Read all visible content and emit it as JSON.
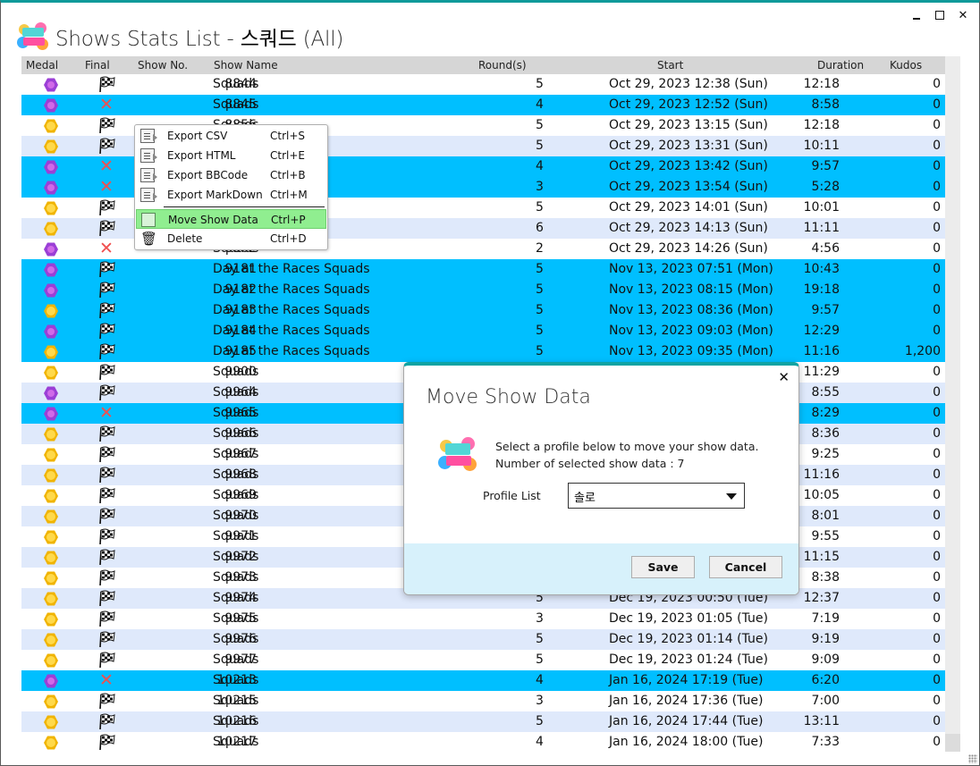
{
  "window": {
    "title_prefix": "Shows Stats List - ",
    "title_profile": "스쿼드",
    "title_suffix": " (All)",
    "controls": {
      "minimize": "minimize",
      "maximize": "maximize",
      "close": "✕"
    }
  },
  "colors": {
    "accent": "#0f9a9a",
    "header_bg": "#d6d6d6",
    "row_alt": "#dfe9fb",
    "row_selected": "#00bfff",
    "menu_highlight": "#90ee90",
    "dialog_footer": "#d7f1fb",
    "medal_purple": "#9b3fd6",
    "medal_gold": "#f0b400",
    "fail_x": "#f04f4f"
  },
  "grid": {
    "columns": [
      "Medal",
      "Final",
      "Show No.",
      "Show Name",
      "Round(s)",
      "Start",
      "Duration",
      "Kudos"
    ],
    "rows": [
      {
        "medal": "purple",
        "final": "flag",
        "num": "8844",
        "name": "Squads",
        "rounds": "5",
        "start": "Oct 29, 2023 12:38 (Sun)",
        "duration": "12:18",
        "kudos": "0",
        "state": "normal"
      },
      {
        "medal": "purple",
        "final": "x",
        "num": "8845",
        "name": "Squads",
        "rounds": "4",
        "start": "Oct 29, 2023 12:52 (Sun)",
        "duration": "8:58",
        "kudos": "0",
        "state": "sel"
      },
      {
        "medal": "gold",
        "final": "flag",
        "num": "8856",
        "name": "Squads",
        "rounds": "5",
        "start": "Oct 29, 2023 13:15 (Sun)",
        "duration": "12:18",
        "kudos": "0",
        "state": "normal"
      },
      {
        "medal": "gold",
        "final": "flag",
        "num": "",
        "name": "",
        "rounds": "5",
        "start": "Oct 29, 2023 13:31 (Sun)",
        "duration": "10:11",
        "kudos": "0",
        "state": "alt"
      },
      {
        "medal": "purple",
        "final": "x",
        "num": "",
        "name": "",
        "rounds": "4",
        "start": "Oct 29, 2023 13:42 (Sun)",
        "duration": "9:57",
        "kudos": "0",
        "state": "sel"
      },
      {
        "medal": "purple",
        "final": "x",
        "num": "",
        "name": "",
        "rounds": "3",
        "start": "Oct 29, 2023 13:54 (Sun)",
        "duration": "5:28",
        "kudos": "0",
        "state": "sel"
      },
      {
        "medal": "gold",
        "final": "flag",
        "num": "",
        "name": "",
        "rounds": "5",
        "start": "Oct 29, 2023 14:01 (Sun)",
        "duration": "10:01",
        "kudos": "0",
        "state": "normal"
      },
      {
        "medal": "gold",
        "final": "flag",
        "num": "",
        "name": "",
        "rounds": "6",
        "start": "Oct 29, 2023 14:13 (Sun)",
        "duration": "11:11",
        "kudos": "0",
        "state": "alt"
      },
      {
        "medal": "purple",
        "final": "x",
        "num": "8862",
        "name": "Squads",
        "rounds": "2",
        "start": "Oct 29, 2023 14:26 (Sun)",
        "duration": "4:56",
        "kudos": "0",
        "state": "normal"
      },
      {
        "medal": "purple",
        "final": "flag",
        "num": "9181",
        "name": "Day at the Races Squads",
        "rounds": "5",
        "start": "Nov 13, 2023 07:51 (Mon)",
        "duration": "10:43",
        "kudos": "0",
        "state": "sel"
      },
      {
        "medal": "purple",
        "final": "flag",
        "num": "9182",
        "name": "Day at the Races Squads",
        "rounds": "5",
        "start": "Nov 13, 2023 08:15 (Mon)",
        "duration": "19:18",
        "kudos": "0",
        "state": "sel"
      },
      {
        "medal": "gold",
        "final": "flag",
        "num": "9183",
        "name": "Day at the Races Squads",
        "rounds": "5",
        "start": "Nov 13, 2023 08:36 (Mon)",
        "duration": "9:57",
        "kudos": "0",
        "state": "sel"
      },
      {
        "medal": "purple",
        "final": "flag",
        "num": "9184",
        "name": "Day at the Races Squads",
        "rounds": "5",
        "start": "Nov 13, 2023 09:03 (Mon)",
        "duration": "12:29",
        "kudos": "0",
        "state": "sel"
      },
      {
        "medal": "gold",
        "final": "flag",
        "num": "9185",
        "name": "Day at the Races Squads",
        "rounds": "5",
        "start": "Nov 13, 2023 09:35 (Mon)",
        "duration": "11:16",
        "kudos": "1,200",
        "state": "sel"
      },
      {
        "medal": "gold",
        "final": "flag",
        "num": "9900",
        "name": "Squads",
        "rounds": "",
        "start": "",
        "duration": "11:29",
        "kudos": "0",
        "state": "normal"
      },
      {
        "medal": "purple",
        "final": "flag",
        "num": "9964",
        "name": "Squads",
        "rounds": "",
        "start": "",
        "duration": "8:55",
        "kudos": "0",
        "state": "alt"
      },
      {
        "medal": "purple",
        "final": "x",
        "num": "9965",
        "name": "Squads",
        "rounds": "",
        "start": "",
        "duration": "8:29",
        "kudos": "0",
        "state": "sel"
      },
      {
        "medal": "gold",
        "final": "flag",
        "num": "9966",
        "name": "Squads",
        "rounds": "",
        "start": "",
        "duration": "8:36",
        "kudos": "0",
        "state": "alt"
      },
      {
        "medal": "gold",
        "final": "flag",
        "num": "9967",
        "name": "Squads",
        "rounds": "",
        "start": "",
        "duration": "9:25",
        "kudos": "0",
        "state": "normal"
      },
      {
        "medal": "gold",
        "final": "flag",
        "num": "9968",
        "name": "Squads",
        "rounds": "",
        "start": "",
        "duration": "11:16",
        "kudos": "0",
        "state": "alt"
      },
      {
        "medal": "gold",
        "final": "flag",
        "num": "9969",
        "name": "Squads",
        "rounds": "",
        "start": "",
        "duration": "10:05",
        "kudos": "0",
        "state": "normal"
      },
      {
        "medal": "gold",
        "final": "flag",
        "num": "9970",
        "name": "Squads",
        "rounds": "",
        "start": "",
        "duration": "8:01",
        "kudos": "0",
        "state": "alt"
      },
      {
        "medal": "gold",
        "final": "flag",
        "num": "9971",
        "name": "Squads",
        "rounds": "",
        "start": "",
        "duration": "9:55",
        "kudos": "0",
        "state": "normal"
      },
      {
        "medal": "gold",
        "final": "flag",
        "num": "9972",
        "name": "Squads",
        "rounds": "",
        "start": "",
        "duration": "11:15",
        "kudos": "0",
        "state": "alt"
      },
      {
        "medal": "gold",
        "final": "flag",
        "num": "9973",
        "name": "Squads",
        "rounds": "",
        "start": "",
        "duration": "8:38",
        "kudos": "0",
        "state": "normal"
      },
      {
        "medal": "gold",
        "final": "flag",
        "num": "9974",
        "name": "Squads",
        "rounds": "5",
        "start": "Dec 19, 2023 00:50 (Tue)",
        "duration": "12:37",
        "kudos": "0",
        "state": "alt"
      },
      {
        "medal": "gold",
        "final": "flag",
        "num": "9975",
        "name": "Squads",
        "rounds": "3",
        "start": "Dec 19, 2023 01:05 (Tue)",
        "duration": "7:19",
        "kudos": "0",
        "state": "normal"
      },
      {
        "medal": "gold",
        "final": "flag",
        "num": "9976",
        "name": "Squads",
        "rounds": "5",
        "start": "Dec 19, 2023 01:14 (Tue)",
        "duration": "9:19",
        "kudos": "0",
        "state": "alt"
      },
      {
        "medal": "gold",
        "final": "flag",
        "num": "9977",
        "name": "Squads",
        "rounds": "5",
        "start": "Dec 19, 2023 01:24 (Tue)",
        "duration": "9:09",
        "kudos": "0",
        "state": "normal"
      },
      {
        "medal": "purple",
        "final": "x",
        "num": "10213",
        "name": "Squads",
        "rounds": "4",
        "start": "Jan 16, 2024 17:19 (Tue)",
        "duration": "6:20",
        "kudos": "0",
        "state": "sel"
      },
      {
        "medal": "gold",
        "final": "flag",
        "num": "10215",
        "name": "Squads",
        "rounds": "3",
        "start": "Jan 16, 2024 17:36 (Tue)",
        "duration": "7:00",
        "kudos": "0",
        "state": "normal"
      },
      {
        "medal": "gold",
        "final": "flag",
        "num": "10216",
        "name": "Squads",
        "rounds": "5",
        "start": "Jan 16, 2024 17:44 (Tue)",
        "duration": "13:11",
        "kudos": "0",
        "state": "alt"
      },
      {
        "medal": "gold",
        "final": "flag",
        "num": "10217",
        "name": "Squads",
        "rounds": "4",
        "start": "Jan 16, 2024 18:00 (Tue)",
        "duration": "7:33",
        "kudos": "0",
        "state": "normal"
      }
    ]
  },
  "context_menu": {
    "items": [
      {
        "label": "Export CSV",
        "shortcut": "Ctrl+S",
        "icon": "export-icon"
      },
      {
        "label": "Export HTML",
        "shortcut": "Ctrl+E",
        "icon": "export-icon"
      },
      {
        "label": "Export BBCode",
        "shortcut": "Ctrl+B",
        "icon": "export-icon"
      },
      {
        "label": "Export MarkDown",
        "shortcut": "Ctrl+M",
        "icon": "export-icon"
      },
      {
        "label": "Move Show Data",
        "shortcut": "Ctrl+P",
        "icon": "move-data-icon"
      },
      {
        "label": "Delete",
        "shortcut": "Ctrl+D",
        "icon": "trash-icon"
      }
    ]
  },
  "dialog": {
    "title": "Move Show Data",
    "message_line1": "Select a profile below to move your show data.",
    "message_line2": "Number of selected show data : 7",
    "profile_label": "Profile List",
    "profile_value": "솔로",
    "save_label": "Save",
    "cancel_label": "Cancel",
    "close": "✕"
  }
}
